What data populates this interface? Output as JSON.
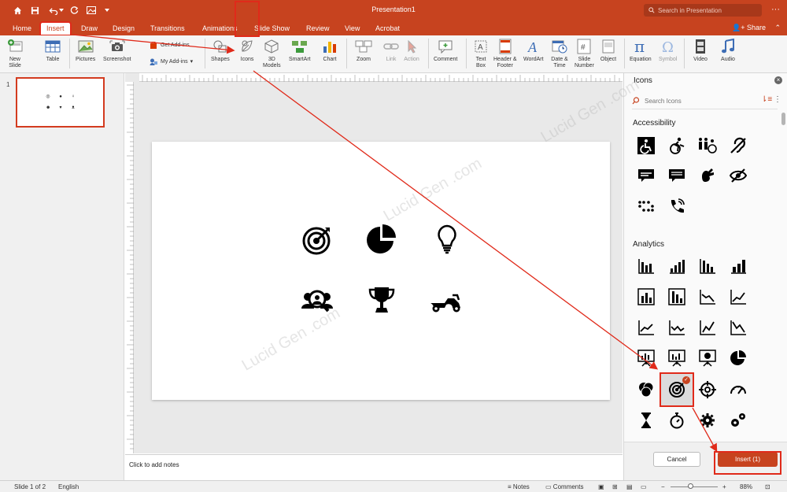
{
  "window": {
    "title": "Presentation1",
    "search_placeholder": "Search in Presentation"
  },
  "tabs": [
    "Home",
    "Insert",
    "Draw",
    "Design",
    "Transitions",
    "Animations",
    "Slide Show",
    "Review",
    "View",
    "Acrobat"
  ],
  "active_tab": "Insert",
  "share_label": "Share",
  "ribbon": {
    "new_slide": "New\nSlide",
    "table": "Table",
    "pictures": "Pictures",
    "screenshot": "Screenshot",
    "get_addins": "Get Add-ins",
    "my_addins": "My Add-ins",
    "shapes": "Shapes",
    "icons": "Icons",
    "models_3d": "3D\nModels",
    "smartart": "SmartArt",
    "chart": "Chart",
    "zoom": "Zoom",
    "link": "Link",
    "action": "Action",
    "comment": "Comment",
    "text_box": "Text\nBox",
    "header_footer": "Header &\nFooter",
    "wordart": "WordArt",
    "date_time": "Date &\nTime",
    "slide_number": "Slide\nNumber",
    "object": "Object",
    "equation": "Equation",
    "symbol": "Symbol",
    "video": "Video",
    "audio": "Audio"
  },
  "thumbnail": {
    "number": "1"
  },
  "notes_placeholder": "Click to add notes",
  "icons_pane": {
    "title": "Icons",
    "search_placeholder": "Search Icons",
    "categories": [
      "Accessibility",
      "Analytics"
    ],
    "cancel_label": "Cancel",
    "insert_label": "Insert (1)"
  },
  "status": {
    "slide_info": "Slide 1 of 2",
    "language": "English",
    "notes": "Notes",
    "comments": "Comments",
    "zoom": "88%"
  },
  "watermark": "Lucid Gen .com",
  "colors": {
    "accent": "#c7431f",
    "highlight": "#e02a1a"
  }
}
